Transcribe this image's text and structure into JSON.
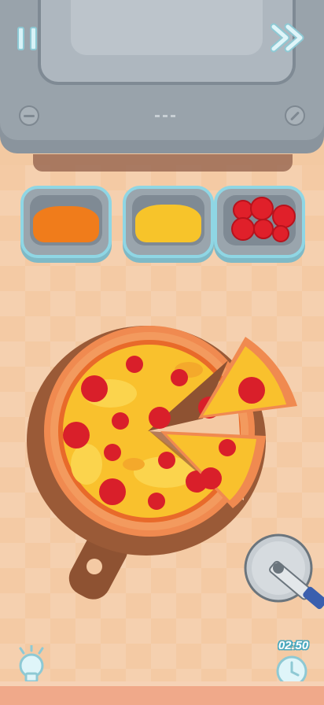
{
  "hud": {
    "timer": "02:50"
  },
  "icons": {
    "pause": "pause-icon",
    "skip": "fast-forward-icon",
    "hint": "lightbulb-icon",
    "timer": "clock-icon",
    "cutter": "pizza-cutter-icon"
  },
  "ingredients": [
    "tomato-sauce",
    "cheese",
    "pepperoni"
  ],
  "colors": {
    "sauce": "#f07c1b",
    "cheese": "#f7c42a",
    "pepperoni": "#e0202a",
    "crust": "#f08a50",
    "board": "#9a5a37",
    "oven": "#99a3ab",
    "accent": "#8fd6e4"
  }
}
